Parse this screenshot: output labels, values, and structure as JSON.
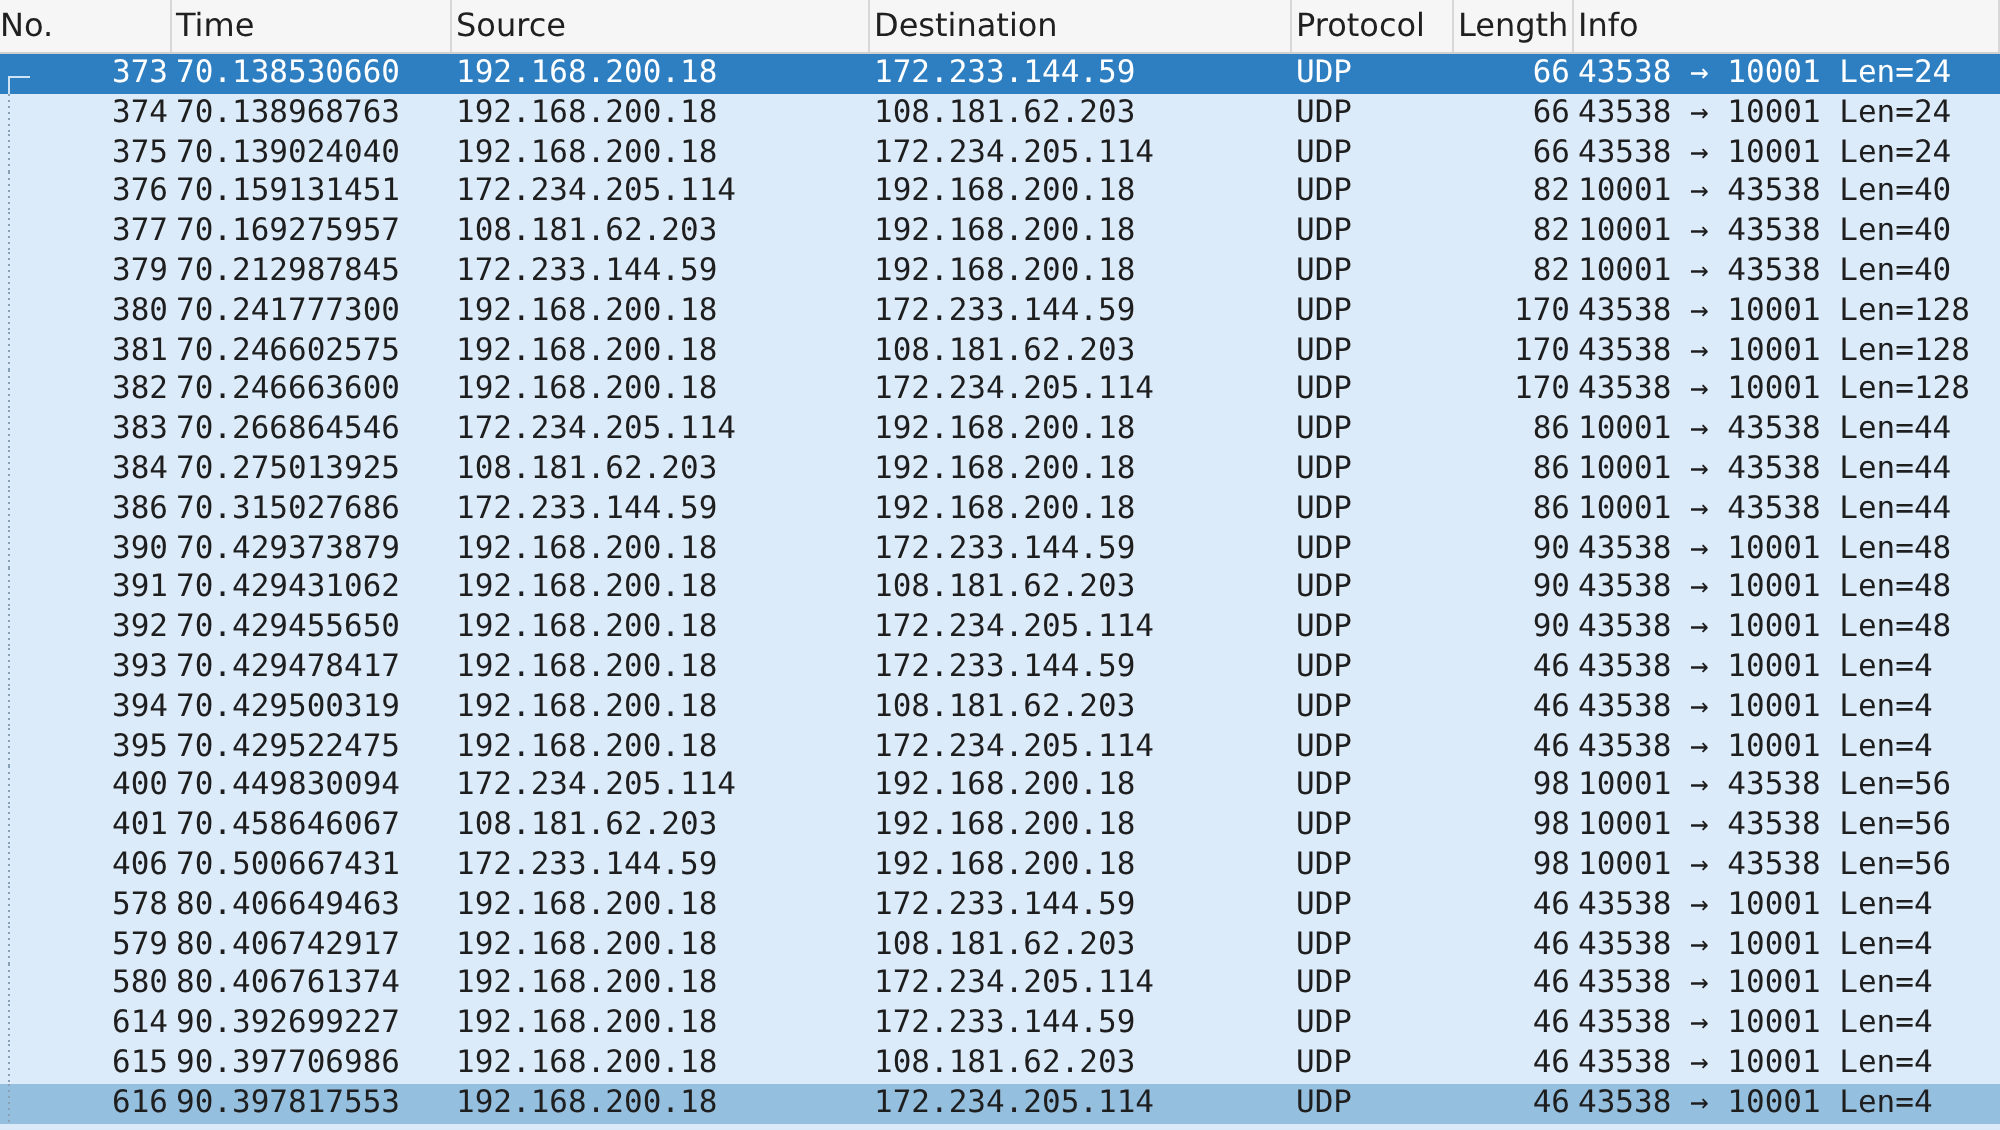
{
  "columns": [
    "No.",
    "Time",
    "Source",
    "Destination",
    "Protocol",
    "Length",
    "Info"
  ],
  "rows": [
    {
      "no": "373",
      "time": "70.138530660",
      "source": "192.168.200.18",
      "destination": "172.233.144.59",
      "protocol": "UDP",
      "length": "66",
      "info": "43538 → 10001 Len=24",
      "selected": true,
      "hovered": false
    },
    {
      "no": "374",
      "time": "70.138968763",
      "source": "192.168.200.18",
      "destination": "108.181.62.203",
      "protocol": "UDP",
      "length": "66",
      "info": "43538 → 10001 Len=24",
      "selected": false,
      "hovered": false
    },
    {
      "no": "375",
      "time": "70.139024040",
      "source": "192.168.200.18",
      "destination": "172.234.205.114",
      "protocol": "UDP",
      "length": "66",
      "info": "43538 → 10001 Len=24",
      "selected": false,
      "hovered": false
    },
    {
      "no": "376",
      "time": "70.159131451",
      "source": "172.234.205.114",
      "destination": "192.168.200.18",
      "protocol": "UDP",
      "length": "82",
      "info": "10001 → 43538 Len=40",
      "selected": false,
      "hovered": false
    },
    {
      "no": "377",
      "time": "70.169275957",
      "source": "108.181.62.203",
      "destination": "192.168.200.18",
      "protocol": "UDP",
      "length": "82",
      "info": "10001 → 43538 Len=40",
      "selected": false,
      "hovered": false
    },
    {
      "no": "379",
      "time": "70.212987845",
      "source": "172.233.144.59",
      "destination": "192.168.200.18",
      "protocol": "UDP",
      "length": "82",
      "info": "10001 → 43538 Len=40",
      "selected": false,
      "hovered": false
    },
    {
      "no": "380",
      "time": "70.241777300",
      "source": "192.168.200.18",
      "destination": "172.233.144.59",
      "protocol": "UDP",
      "length": "170",
      "info": "43538 → 10001 Len=128",
      "selected": false,
      "hovered": false
    },
    {
      "no": "381",
      "time": "70.246602575",
      "source": "192.168.200.18",
      "destination": "108.181.62.203",
      "protocol": "UDP",
      "length": "170",
      "info": "43538 → 10001 Len=128",
      "selected": false,
      "hovered": false
    },
    {
      "no": "382",
      "time": "70.246663600",
      "source": "192.168.200.18",
      "destination": "172.234.205.114",
      "protocol": "UDP",
      "length": "170",
      "info": "43538 → 10001 Len=128",
      "selected": false,
      "hovered": false
    },
    {
      "no": "383",
      "time": "70.266864546",
      "source": "172.234.205.114",
      "destination": "192.168.200.18",
      "protocol": "UDP",
      "length": "86",
      "info": "10001 → 43538 Len=44",
      "selected": false,
      "hovered": false
    },
    {
      "no": "384",
      "time": "70.275013925",
      "source": "108.181.62.203",
      "destination": "192.168.200.18",
      "protocol": "UDP",
      "length": "86",
      "info": "10001 → 43538 Len=44",
      "selected": false,
      "hovered": false
    },
    {
      "no": "386",
      "time": "70.315027686",
      "source": "172.233.144.59",
      "destination": "192.168.200.18",
      "protocol": "UDP",
      "length": "86",
      "info": "10001 → 43538 Len=44",
      "selected": false,
      "hovered": false
    },
    {
      "no": "390",
      "time": "70.429373879",
      "source": "192.168.200.18",
      "destination": "172.233.144.59",
      "protocol": "UDP",
      "length": "90",
      "info": "43538 → 10001 Len=48",
      "selected": false,
      "hovered": false
    },
    {
      "no": "391",
      "time": "70.429431062",
      "source": "192.168.200.18",
      "destination": "108.181.62.203",
      "protocol": "UDP",
      "length": "90",
      "info": "43538 → 10001 Len=48",
      "selected": false,
      "hovered": false
    },
    {
      "no": "392",
      "time": "70.429455650",
      "source": "192.168.200.18",
      "destination": "172.234.205.114",
      "protocol": "UDP",
      "length": "90",
      "info": "43538 → 10001 Len=48",
      "selected": false,
      "hovered": false
    },
    {
      "no": "393",
      "time": "70.429478417",
      "source": "192.168.200.18",
      "destination": "172.233.144.59",
      "protocol": "UDP",
      "length": "46",
      "info": "43538 → 10001 Len=4",
      "selected": false,
      "hovered": false
    },
    {
      "no": "394",
      "time": "70.429500319",
      "source": "192.168.200.18",
      "destination": "108.181.62.203",
      "protocol": "UDP",
      "length": "46",
      "info": "43538 → 10001 Len=4",
      "selected": false,
      "hovered": false
    },
    {
      "no": "395",
      "time": "70.429522475",
      "source": "192.168.200.18",
      "destination": "172.234.205.114",
      "protocol": "UDP",
      "length": "46",
      "info": "43538 → 10001 Len=4",
      "selected": false,
      "hovered": false
    },
    {
      "no": "400",
      "time": "70.449830094",
      "source": "172.234.205.114",
      "destination": "192.168.200.18",
      "protocol": "UDP",
      "length": "98",
      "info": "10001 → 43538 Len=56",
      "selected": false,
      "hovered": false
    },
    {
      "no": "401",
      "time": "70.458646067",
      "source": "108.181.62.203",
      "destination": "192.168.200.18",
      "protocol": "UDP",
      "length": "98",
      "info": "10001 → 43538 Len=56",
      "selected": false,
      "hovered": false
    },
    {
      "no": "406",
      "time": "70.500667431",
      "source": "172.233.144.59",
      "destination": "192.168.200.18",
      "protocol": "UDP",
      "length": "98",
      "info": "10001 → 43538 Len=56",
      "selected": false,
      "hovered": false
    },
    {
      "no": "578",
      "time": "80.406649463",
      "source": "192.168.200.18",
      "destination": "172.233.144.59",
      "protocol": "UDP",
      "length": "46",
      "info": "43538 → 10001 Len=4",
      "selected": false,
      "hovered": false
    },
    {
      "no": "579",
      "time": "80.406742917",
      "source": "192.168.200.18",
      "destination": "108.181.62.203",
      "protocol": "UDP",
      "length": "46",
      "info": "43538 → 10001 Len=4",
      "selected": false,
      "hovered": false
    },
    {
      "no": "580",
      "time": "80.406761374",
      "source": "192.168.200.18",
      "destination": "172.234.205.114",
      "protocol": "UDP",
      "length": "46",
      "info": "43538 → 10001 Len=4",
      "selected": false,
      "hovered": false
    },
    {
      "no": "614",
      "time": "90.392699227",
      "source": "192.168.200.18",
      "destination": "172.233.144.59",
      "protocol": "UDP",
      "length": "46",
      "info": "43538 → 10001 Len=4",
      "selected": false,
      "hovered": false
    },
    {
      "no": "615",
      "time": "90.397706986",
      "source": "192.168.200.18",
      "destination": "108.181.62.203",
      "protocol": "UDP",
      "length": "46",
      "info": "43538 → 10001 Len=4",
      "selected": false,
      "hovered": false
    },
    {
      "no": "616",
      "time": "90.397817553",
      "source": "192.168.200.18",
      "destination": "172.234.205.114",
      "protocol": "UDP",
      "length": "46",
      "info": "43538 → 10001 Len=4",
      "selected": false,
      "hovered": true
    }
  ]
}
